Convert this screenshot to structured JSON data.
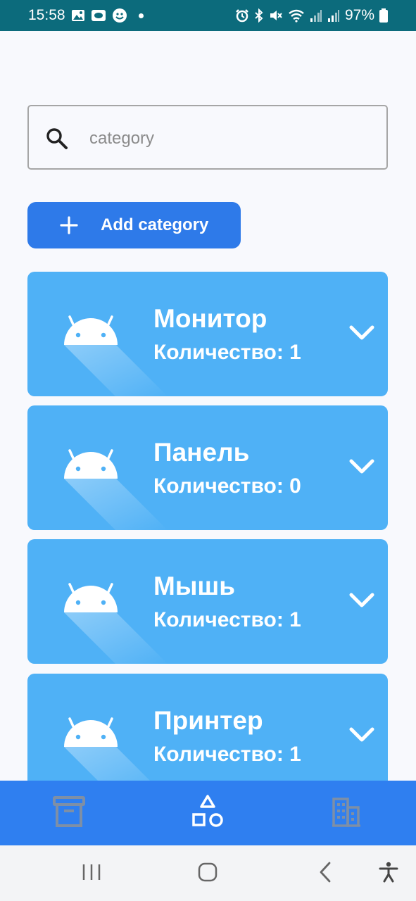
{
  "status_bar": {
    "time": "15:58",
    "battery": "97%"
  },
  "search": {
    "placeholder": "category",
    "value": ""
  },
  "add_button": {
    "label": "Add category"
  },
  "categories": [
    {
      "name": "Монитор",
      "count_label": "Количество: 1"
    },
    {
      "name": "Панель",
      "count_label": "Количество: 0"
    },
    {
      "name": "Мышь",
      "count_label": "Количество: 1"
    },
    {
      "name": "Принтер",
      "count_label": "Количество: 1"
    }
  ],
  "bottom_nav": {
    "items": [
      {
        "icon": "archive-icon",
        "active": false
      },
      {
        "icon": "shapes-icon",
        "active": true
      },
      {
        "icon": "building-icon",
        "active": false
      }
    ]
  },
  "colors": {
    "status_bar": "#0c6b7c",
    "primary": "#2e7ae9",
    "card": "#4fb1f6",
    "nav_bar": "#2f7ff0",
    "nav_inactive": "#7e8fa6"
  }
}
